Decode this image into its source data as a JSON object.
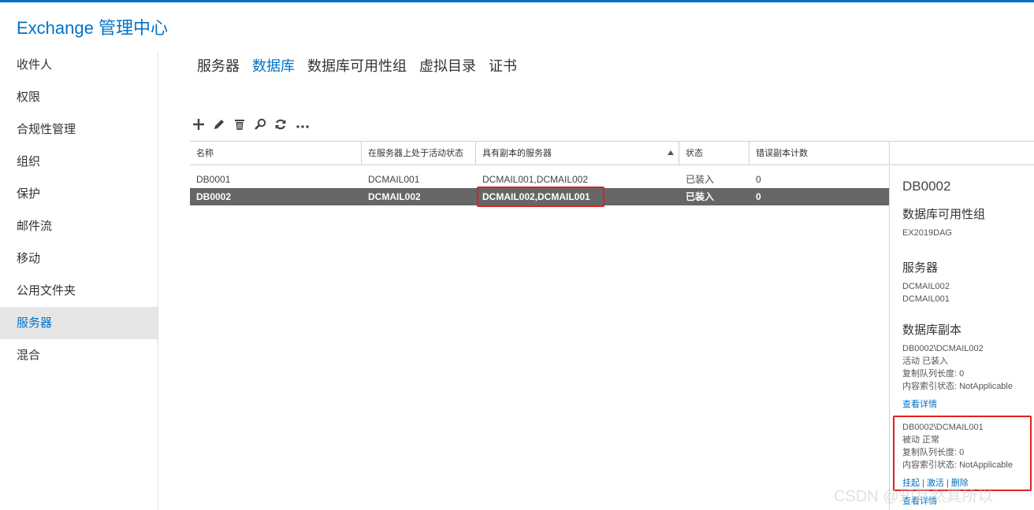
{
  "app": {
    "title": "Exchange 管理中心"
  },
  "sidebar": {
    "items": [
      {
        "label": "收件人"
      },
      {
        "label": "权限"
      },
      {
        "label": "合规性管理"
      },
      {
        "label": "组织"
      },
      {
        "label": "保护"
      },
      {
        "label": "邮件流"
      },
      {
        "label": "移动"
      },
      {
        "label": "公用文件夹"
      },
      {
        "label": "服务器",
        "active": true
      },
      {
        "label": "混合"
      }
    ]
  },
  "tabs": [
    {
      "label": "服务器"
    },
    {
      "label": "数据库",
      "active": true
    },
    {
      "label": "数据库可用性组"
    },
    {
      "label": "虚拟目录"
    },
    {
      "label": "证书"
    }
  ],
  "toolbar": {
    "icons": [
      "add-icon",
      "edit-icon",
      "delete-icon",
      "search-icon",
      "refresh-icon",
      "more-icon"
    ],
    "more_label": "..."
  },
  "grid": {
    "columns": [
      "名称",
      "在服务器上处于活动状态",
      "具有副本的服务器",
      "状态",
      "错误副本计数",
      ""
    ],
    "sorted_column": 2,
    "rows": [
      {
        "name": "DB0001",
        "active_on": "DCMAIL001",
        "copies": "DCMAIL001,DCMAIL002",
        "status": "已装入",
        "errors": "0"
      },
      {
        "name": "DB0002",
        "active_on": "DCMAIL002",
        "copies": "DCMAIL002,DCMAIL001",
        "status": "已装入",
        "errors": "0",
        "selected": true
      }
    ]
  },
  "details": {
    "title": "DB0002",
    "dag_heading": "数据库可用性组",
    "dag_value": "EX2019DAG",
    "servers_heading": "服务器",
    "servers": [
      "DCMAIL002",
      "DCMAIL001"
    ],
    "copies_heading": "数据库副本",
    "copies": [
      {
        "name": "DB0002\\DCMAIL002",
        "state": "活动 已装入",
        "queue": "复制队列长度: 0",
        "index": "内容索引状态: NotApplicable",
        "view_details": "查看详情"
      },
      {
        "name": "DB0002\\DCMAIL001",
        "state": "被动 正常",
        "queue": "复制队列长度: 0",
        "index": "内容索引状态: NotApplicable",
        "suspend": "挂起",
        "activate": "激活",
        "remove": "删除",
        "view_details": "查看详情"
      }
    ]
  },
  "colors": {
    "accent": "#0072c6",
    "selected_row": "#666666",
    "highlight": "#e02020"
  },
  "watermark": "CSDN @知其然其所以"
}
